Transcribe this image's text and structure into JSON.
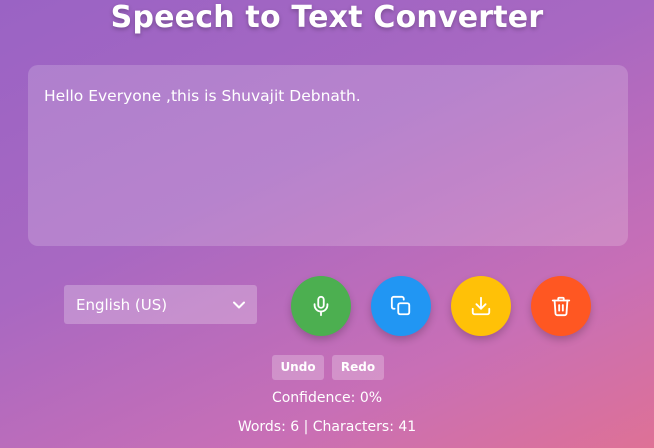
{
  "page": {
    "title": "Speech to Text Converter"
  },
  "transcript": {
    "text": "Hello Everyone ,this is Shuvajit Debnath."
  },
  "language": {
    "selected": "English (US)"
  },
  "actions": {
    "mic": {
      "icon": "microphone-icon",
      "color": "#4caf50"
    },
    "copy": {
      "icon": "copy-icon",
      "color": "#2196f3"
    },
    "download": {
      "icon": "download-icon",
      "color": "#ffc107"
    },
    "clear": {
      "icon": "trash-icon",
      "color": "#ff5722"
    }
  },
  "history": {
    "undo_label": "Undo",
    "redo_label": "Redo"
  },
  "stats": {
    "confidence_text": "Confidence: 0%",
    "counts_text": "Words: 6 | Characters: 41"
  }
}
